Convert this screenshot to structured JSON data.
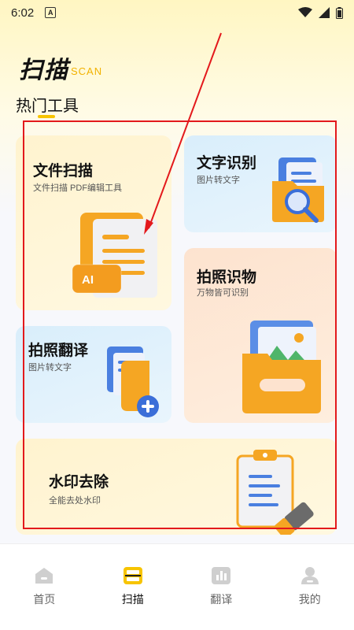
{
  "status_bar": {
    "time": "6:02",
    "notification": "A"
  },
  "header": {
    "title": "扫描",
    "subtitle": "SCAN"
  },
  "section": {
    "title": "热门工具"
  },
  "tools": [
    {
      "title": "文件扫描",
      "subtitle": "文件扫描 PDF编辑工具",
      "badge": "AI",
      "color": "#fff3cf"
    },
    {
      "title": "文字识别",
      "subtitle": "图片转文字",
      "color": "#d9eefb"
    },
    {
      "title": "拍照识物",
      "subtitle": "万物皆可识别",
      "color": "#fde3cf"
    },
    {
      "title": "拍照翻译",
      "subtitle": "图片转文字",
      "color": "#d9eefb"
    },
    {
      "title": "水印去除",
      "subtitle": "全能去处水印",
      "color": "#fff3cf"
    }
  ],
  "nav": {
    "items": [
      {
        "label": "首页",
        "icon": "home-icon",
        "active": false
      },
      {
        "label": "扫描",
        "icon": "scan-icon",
        "active": true
      },
      {
        "label": "翻译",
        "icon": "translate-icon",
        "active": false
      },
      {
        "label": "我的",
        "icon": "profile-icon",
        "active": false
      }
    ]
  },
  "colors": {
    "accent": "#f7c400",
    "annotation": "#e3191c",
    "folder": "#f5a623"
  }
}
